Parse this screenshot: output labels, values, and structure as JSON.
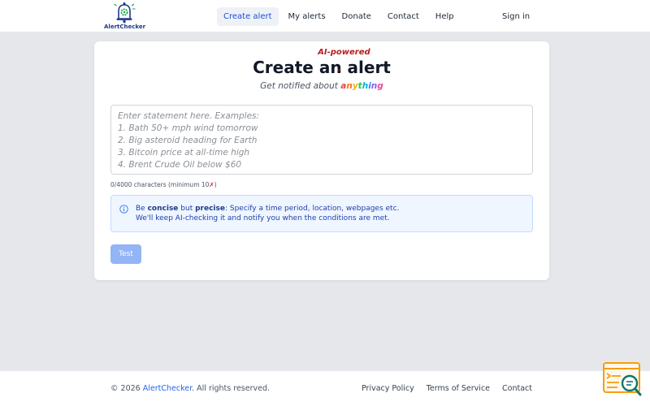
{
  "header": {
    "logo_text": "AlertChecker",
    "nav": [
      {
        "label": "Create alert",
        "active": true
      },
      {
        "label": "My alerts"
      },
      {
        "label": "Donate"
      },
      {
        "label": "Contact"
      },
      {
        "label": "Help"
      }
    ],
    "signin_label": "Sign in"
  },
  "card": {
    "title_create": "Create",
    "title_an": "an",
    "title_alert": "alert",
    "title_annotation": "AI-powered",
    "subtitle_prefix": "Get notified about",
    "subtitle_emphasis": "anything",
    "placeholder_lines": [
      "Enter statement here. Examples:",
      "1. Bath 50+ mph wind tomorrow",
      "2. Big asteroid heading for Earth",
      "3. Bitcoin price at all-time high",
      "4. Brent Crude Oil below $60"
    ],
    "counter_text": "0/4000 characters (minimum 10",
    "counter_mark": "✗",
    "counter_close": ")",
    "info": {
      "be": "Be",
      "concise": "concise",
      "but": "but",
      "precise": "precise",
      "rest": ": Specify a time period, location, webpages etc.",
      "line2": "We'll keep AI-checking it and notify you when the conditions are met."
    },
    "test_label": "Test"
  },
  "footer": {
    "copyright_prefix": "© 2026",
    "brand": "AlertChecker",
    "copyright_suffix": ". All rights reserved.",
    "links": [
      "Privacy Policy",
      "Terms of Service",
      "Contact"
    ]
  },
  "colors": {
    "accent": "#2563eb",
    "info_bg": "#eff6ff",
    "button_disabled": "#93b4f5",
    "annotation_red": "#b91c1c",
    "rainbow": [
      "#ef4444",
      "#f97316",
      "#eab308",
      "#22c55e",
      "#06b6d4",
      "#3b82f6",
      "#8b5cf6",
      "#ec4899"
    ]
  },
  "icons": {
    "logo": "bell-gear-icon",
    "info": "info-circle-icon",
    "fab": "terminal-search-icon"
  }
}
